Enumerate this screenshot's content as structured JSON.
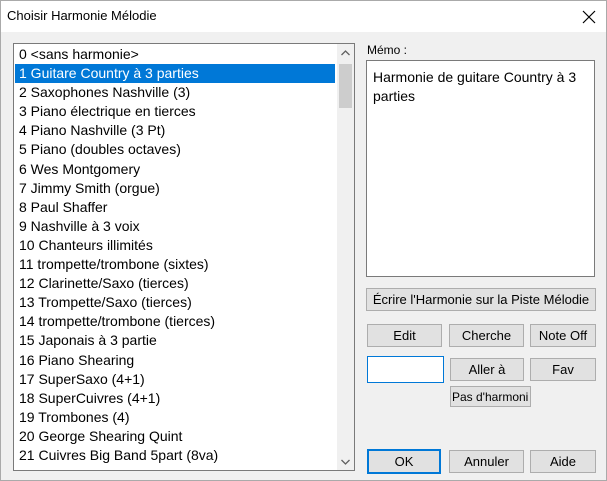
{
  "window": {
    "title": "Choisir Harmonie Mélodie",
    "close_glyph": "✕"
  },
  "harmony_list": {
    "selected_index": 1,
    "items": [
      "0 <sans harmonie>",
      "1 Guitare Country à 3 parties",
      "2 Saxophones Nashville (3)",
      "3 Piano électrique en tierces",
      "4 Piano Nashville (3 Pt)",
      "5 Piano (doubles octaves)",
      "6 Wes Montgomery",
      "7 Jimmy Smith (orgue)",
      "8 Paul Shaffer",
      "9 Nashville à 3 voix",
      "10 Chanteurs illimités",
      "11 trompette/trombone (sixtes)",
      "12 Clarinette/Saxo (tierces)",
      "13 Trompette/Saxo (tierces)",
      "14 trompette/trombone (tierces)",
      "15 Japonais à 3 partie",
      "16 Piano Shearing",
      "17 SuperSaxo (4+1)",
      "18 SuperCuivres (4+1)",
      "19 Trombones (4)",
      "20 George Shearing Quint",
      "21 Cuivres Big Band 5part (8va)"
    ]
  },
  "memo": {
    "label": "Mémo :",
    "text": "Harmonie de guitare Country à 3 parties"
  },
  "buttons": {
    "write_harmony": "Écrire l'Harmonie sur la Piste Mélodie",
    "edit": "Edit",
    "search": "Cherche",
    "note_off": "Note Off",
    "go_to": "Aller à",
    "fav": "Fav",
    "no_harmony": "Pas d'harmoni",
    "ok": "OK",
    "cancel": "Annuler",
    "help": "Aide"
  },
  "goto_input": {
    "value": ""
  },
  "icons": {
    "scroll_up": "chevron-up-icon",
    "scroll_down": "chevron-down-icon",
    "close": "close-icon"
  },
  "colors": {
    "selection": "#0078d7",
    "dialog_bg": "#f0f0f0",
    "button_bg": "#e1e1e1"
  }
}
